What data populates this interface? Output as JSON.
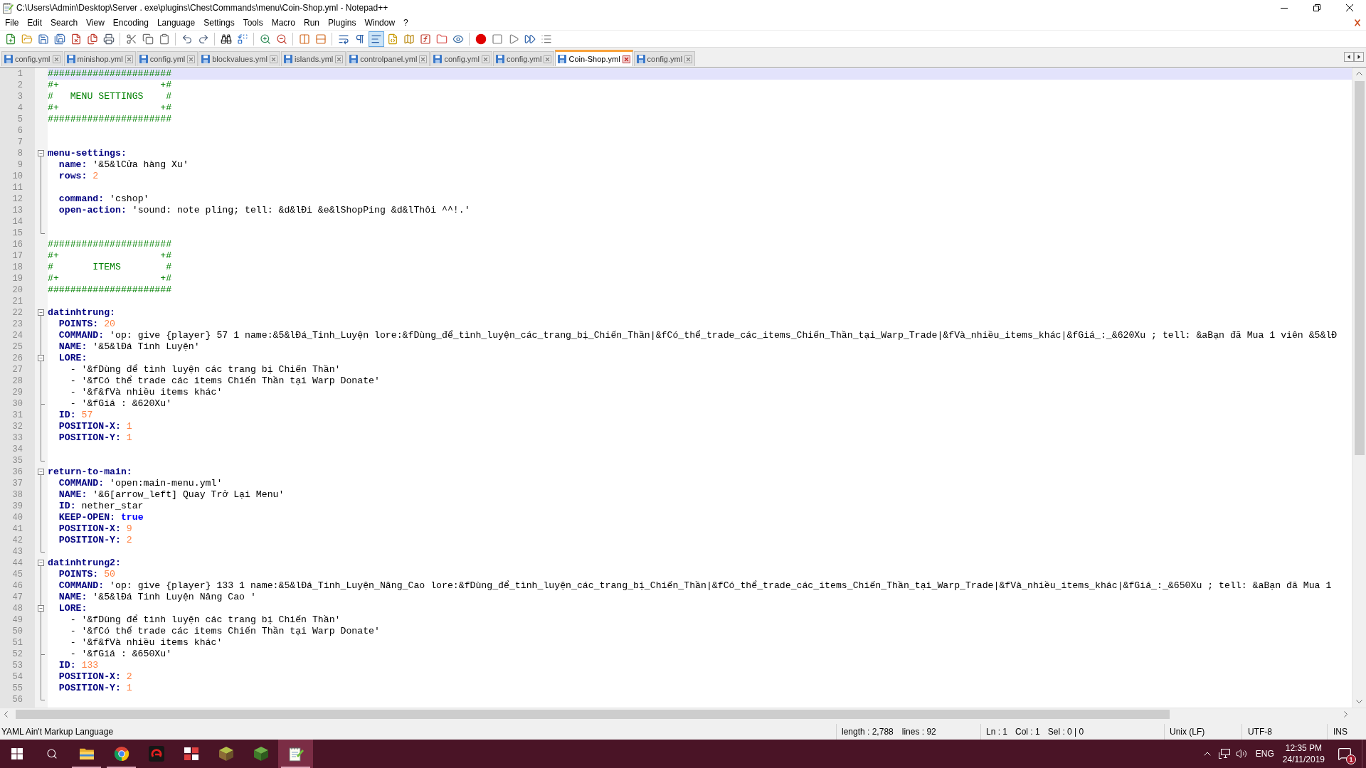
{
  "window": {
    "title": "C:\\Users\\Admin\\Desktop\\Server . exe\\plugins\\ChestCommands\\menu\\Coin-Shop.yml - Notepad++"
  },
  "menu_bar": [
    "File",
    "Edit",
    "Search",
    "View",
    "Encoding",
    "Language",
    "Settings",
    "Tools",
    "Macro",
    "Run",
    "Plugins",
    "Window",
    "?"
  ],
  "toolbar": {
    "groups": [
      {
        "buttons": [
          {
            "kind": "new",
            "pressed": false
          },
          {
            "kind": "open",
            "pressed": false
          },
          {
            "kind": "save",
            "pressed": false
          },
          {
            "kind": "saveall",
            "pressed": false
          },
          {
            "kind": "close",
            "pressed": false
          },
          {
            "kind": "closeall",
            "pressed": false
          },
          {
            "kind": "print",
            "pressed": false
          }
        ]
      },
      {
        "buttons": [
          {
            "kind": "cut",
            "pressed": false
          },
          {
            "kind": "copy",
            "pressed": false
          },
          {
            "kind": "paste",
            "pressed": false
          }
        ]
      },
      {
        "buttons": [
          {
            "kind": "undo",
            "pressed": false
          },
          {
            "kind": "redo",
            "pressed": false
          }
        ]
      },
      {
        "buttons": [
          {
            "kind": "find",
            "pressed": false
          },
          {
            "kind": "replace",
            "pressed": false
          }
        ]
      },
      {
        "buttons": [
          {
            "kind": "zoomin",
            "pressed": false
          },
          {
            "kind": "zoomout",
            "pressed": false
          }
        ]
      },
      {
        "buttons": [
          {
            "kind": "syncv",
            "pressed": false
          },
          {
            "kind": "synch",
            "pressed": false
          }
        ]
      },
      {
        "buttons": [
          {
            "kind": "wrap",
            "pressed": false
          },
          {
            "kind": "allchars",
            "pressed": false
          },
          {
            "kind": "indentguide",
            "pressed": true
          },
          {
            "kind": "udl",
            "pressed": false
          },
          {
            "kind": "docmap",
            "pressed": false
          },
          {
            "kind": "functions",
            "pressed": false
          },
          {
            "kind": "workspace",
            "pressed": false
          },
          {
            "kind": "monitor",
            "pressed": false
          }
        ]
      },
      {
        "buttons": [
          {
            "kind": "record",
            "pressed": false
          },
          {
            "kind": "stop",
            "pressed": false
          },
          {
            "kind": "play",
            "pressed": false
          },
          {
            "kind": "playmulti",
            "pressed": false
          },
          {
            "kind": "savemacro",
            "pressed": false
          }
        ]
      }
    ]
  },
  "tabs": [
    {
      "label": "config.yml",
      "selected": false
    },
    {
      "label": "minishop.yml",
      "selected": false
    },
    {
      "label": "config.yml",
      "selected": false
    },
    {
      "label": "blockvalues.yml",
      "selected": false
    },
    {
      "label": "islands.yml",
      "selected": false
    },
    {
      "label": "controlpanel.yml",
      "selected": false
    },
    {
      "label": "config.yml",
      "selected": false
    },
    {
      "label": "config.yml",
      "selected": false
    },
    {
      "label": "Coin-Shop.yml",
      "selected": true
    },
    {
      "label": "config.yml",
      "selected": false
    }
  ],
  "editor": {
    "lines": [
      {
        "number": "1",
        "current": true,
        "tokens": [
          {
            "kind": "comment",
            "text": "######################"
          }
        ]
      },
      {
        "number": "2",
        "current": false,
        "tokens": [
          {
            "kind": "comment",
            "text": "#+                  +#"
          }
        ]
      },
      {
        "number": "3",
        "current": false,
        "tokens": [
          {
            "kind": "comment",
            "text": "#   MENU SETTINGS    #"
          }
        ]
      },
      {
        "number": "4",
        "current": false,
        "tokens": [
          {
            "kind": "comment",
            "text": "#+                  +#"
          }
        ]
      },
      {
        "number": "5",
        "current": false,
        "tokens": [
          {
            "kind": "comment",
            "text": "######################"
          }
        ]
      },
      {
        "number": "6",
        "current": false
      },
      {
        "number": "7",
        "current": false
      },
      {
        "number": "8",
        "current": false,
        "fold": {
          "kind": "start"
        },
        "tokens": [
          {
            "kind": "key",
            "text": "menu-settings:"
          }
        ]
      },
      {
        "number": "9",
        "current": false,
        "fold": {
          "kind": "middle"
        },
        "tokens": [
          {
            "kind": "key",
            "text": "  name: "
          },
          {
            "kind": "plain",
            "text": "'&5&lCửa hàng Xu'"
          }
        ]
      },
      {
        "number": "10",
        "current": false,
        "fold": {
          "kind": "middle"
        },
        "tokens": [
          {
            "kind": "key",
            "text": "  rows: "
          },
          {
            "kind": "number",
            "text": "2"
          }
        ]
      },
      {
        "number": "11",
        "current": false,
        "fold": {
          "kind": "middle"
        }
      },
      {
        "number": "12",
        "current": false,
        "fold": {
          "kind": "middle"
        },
        "tokens": [
          {
            "kind": "key",
            "text": "  command: "
          },
          {
            "kind": "plain",
            "text": "'cshop'"
          }
        ]
      },
      {
        "number": "13",
        "current": false,
        "fold": {
          "kind": "middle"
        },
        "tokens": [
          {
            "kind": "key",
            "text": "  open-action: "
          },
          {
            "kind": "plain",
            "text": "'sound: note pling; tell: &d&lĐi &e&lShopPing &d&lThôi ^^!.'"
          }
        ]
      },
      {
        "number": "14",
        "current": false,
        "fold": {
          "kind": "middle"
        }
      },
      {
        "number": "15",
        "current": false,
        "fold": {
          "kind": "end"
        }
      },
      {
        "number": "16",
        "current": false,
        "tokens": [
          {
            "kind": "comment",
            "text": "######################"
          }
        ]
      },
      {
        "number": "17",
        "current": false,
        "tokens": [
          {
            "kind": "comment",
            "text": "#+                  +#"
          }
        ]
      },
      {
        "number": "18",
        "current": false,
        "tokens": [
          {
            "kind": "comment",
            "text": "#       ITEMS        #"
          }
        ]
      },
      {
        "number": "19",
        "current": false,
        "tokens": [
          {
            "kind": "comment",
            "text": "#+                  +#"
          }
        ]
      },
      {
        "number": "20",
        "current": false,
        "tokens": [
          {
            "kind": "comment",
            "text": "######################"
          }
        ]
      },
      {
        "number": "21",
        "current": false
      },
      {
        "number": "22",
        "current": false,
        "fold": {
          "kind": "start"
        },
        "tokens": [
          {
            "kind": "key",
            "text": "datinhtrung:"
          }
        ]
      },
      {
        "number": "23",
        "current": false,
        "fold": {
          "kind": "middle"
        },
        "tokens": [
          {
            "kind": "key",
            "text": "  POINTS: "
          },
          {
            "kind": "number",
            "text": "20"
          }
        ]
      },
      {
        "number": "24",
        "current": false,
        "fold": {
          "kind": "middle"
        },
        "tokens": [
          {
            "kind": "key",
            "text": "  COMMAND: "
          },
          {
            "kind": "plain",
            "text": "'op: give {player} 57 1 name:&5&lĐá_Tinh_Luyện lore:&fDùng_để_tình_luyện_các_trang_bị_Chiến_Thần|&fCó_thể_trade_các_items_Chiến_Thần_tại_Warp_Trade|&fVà_nhiều_items_khác|&fGiá_:_&620Xu ; tell: &aBạn đã Mua 1 viên &5&lĐ"
          }
        ]
      },
      {
        "number": "25",
        "current": false,
        "fold": {
          "kind": "middle"
        },
        "tokens": [
          {
            "kind": "key",
            "text": "  NAME: "
          },
          {
            "kind": "plain",
            "text": "'&5&lĐá Tinh Luyện'"
          }
        ]
      },
      {
        "number": "26",
        "current": false,
        "fold": {
          "kind": "substart"
        },
        "tokens": [
          {
            "kind": "key",
            "text": "  LORE:"
          }
        ]
      },
      {
        "number": "27",
        "current": false,
        "fold": {
          "kind": "middle"
        },
        "tokens": [
          {
            "kind": "plain",
            "text": "    - '&fDùng để tình luyện các trang bị Chiến Thần'"
          }
        ]
      },
      {
        "number": "28",
        "current": false,
        "fold": {
          "kind": "middle"
        },
        "tokens": [
          {
            "kind": "plain",
            "text": "    - '&fCó thể trade các items Chiến Thần tại Warp Donate'"
          }
        ]
      },
      {
        "number": "29",
        "current": false,
        "fold": {
          "kind": "middle"
        },
        "tokens": [
          {
            "kind": "plain",
            "text": "    - '&f&fVà nhiều items khác'"
          }
        ]
      },
      {
        "number": "30",
        "current": false,
        "fold": {
          "kind": "subend"
        },
        "tokens": [
          {
            "kind": "plain",
            "text": "    - '&fGiá : &620Xu'"
          }
        ]
      },
      {
        "number": "31",
        "current": false,
        "fold": {
          "kind": "middle"
        },
        "tokens": [
          {
            "kind": "key",
            "text": "  ID: "
          },
          {
            "kind": "number",
            "text": "57"
          }
        ]
      },
      {
        "number": "32",
        "current": false,
        "fold": {
          "kind": "middle"
        },
        "tokens": [
          {
            "kind": "key",
            "text": "  POSITION-X: "
          },
          {
            "kind": "number",
            "text": "1"
          }
        ]
      },
      {
        "number": "33",
        "current": false,
        "fold": {
          "kind": "middle"
        },
        "tokens": [
          {
            "kind": "key",
            "text": "  POSITION-Y: "
          },
          {
            "kind": "number",
            "text": "1"
          }
        ]
      },
      {
        "number": "34",
        "current": false,
        "fold": {
          "kind": "middle"
        }
      },
      {
        "number": "35",
        "current": false,
        "fold": {
          "kind": "end"
        }
      },
      {
        "number": "36",
        "current": false,
        "fold": {
          "kind": "start"
        },
        "tokens": [
          {
            "kind": "key",
            "text": "return-to-main:"
          }
        ]
      },
      {
        "number": "37",
        "current": false,
        "fold": {
          "kind": "middle"
        },
        "tokens": [
          {
            "kind": "key",
            "text": "  COMMAND: "
          },
          {
            "kind": "plain",
            "text": "'open:main-menu.yml'"
          }
        ]
      },
      {
        "number": "38",
        "current": false,
        "fold": {
          "kind": "middle"
        },
        "tokens": [
          {
            "kind": "key",
            "text": "  NAME: "
          },
          {
            "kind": "plain",
            "text": "'&6[arrow_left] Quay Trở Lại Menu'"
          }
        ]
      },
      {
        "number": "39",
        "current": false,
        "fold": {
          "kind": "middle"
        },
        "tokens": [
          {
            "kind": "key",
            "text": "  ID: "
          },
          {
            "kind": "plain",
            "text": "nether_star"
          }
        ]
      },
      {
        "number": "40",
        "current": false,
        "fold": {
          "kind": "middle"
        },
        "tokens": [
          {
            "kind": "key",
            "text": "  KEEP-OPEN: "
          },
          {
            "kind": "keyword",
            "text": "true"
          }
        ]
      },
      {
        "number": "41",
        "current": false,
        "fold": {
          "kind": "middle"
        },
        "tokens": [
          {
            "kind": "key",
            "text": "  POSITION-X: "
          },
          {
            "kind": "number",
            "text": "9"
          }
        ]
      },
      {
        "number": "42",
        "current": false,
        "fold": {
          "kind": "middle"
        },
        "tokens": [
          {
            "kind": "key",
            "text": "  POSITION-Y: "
          },
          {
            "kind": "number",
            "text": "2"
          }
        ]
      },
      {
        "number": "43",
        "current": false,
        "fold": {
          "kind": "end"
        }
      },
      {
        "number": "44",
        "current": false,
        "fold": {
          "kind": "start"
        },
        "tokens": [
          {
            "kind": "key",
            "text": "datinhtrung2:"
          }
        ]
      },
      {
        "number": "45",
        "current": false,
        "fold": {
          "kind": "middle"
        },
        "tokens": [
          {
            "kind": "key",
            "text": "  POINTS: "
          },
          {
            "kind": "number",
            "text": "50"
          }
        ]
      },
      {
        "number": "46",
        "current": false,
        "fold": {
          "kind": "middle"
        },
        "tokens": [
          {
            "kind": "key",
            "text": "  COMMAND: "
          },
          {
            "kind": "plain",
            "text": "'op: give {player} 133 1 name:&5&lĐá_Tinh_Luyện_Nâng_Cao lore:&fDùng_để_tình_luyện_các_trang_bị_Chiến_Thần|&fCó_thể_trade_các_items_Chiến_Thần_tại_Warp_Trade|&fVà_nhiều_items_khác|&fGiá_:_&650Xu ; tell: &aBạn đã Mua 1"
          }
        ]
      },
      {
        "number": "47",
        "current": false,
        "fold": {
          "kind": "middle"
        },
        "tokens": [
          {
            "kind": "key",
            "text": "  NAME: "
          },
          {
            "kind": "plain",
            "text": "'&5&lĐá Tinh Luyện Nâng Cao '"
          }
        ]
      },
      {
        "number": "48",
        "current": false,
        "fold": {
          "kind": "substart"
        },
        "tokens": [
          {
            "kind": "key",
            "text": "  LORE:"
          }
        ]
      },
      {
        "number": "49",
        "current": false,
        "fold": {
          "kind": "middle"
        },
        "tokens": [
          {
            "kind": "plain",
            "text": "    - '&fDùng để tình luyện các trang bị Chiến Thần'"
          }
        ]
      },
      {
        "number": "50",
        "current": false,
        "fold": {
          "kind": "middle"
        },
        "tokens": [
          {
            "kind": "plain",
            "text": "    - '&fCó thể trade các items Chiến Thần tại Warp Donate'"
          }
        ]
      },
      {
        "number": "51",
        "current": false,
        "fold": {
          "kind": "middle"
        },
        "tokens": [
          {
            "kind": "plain",
            "text": "    - '&f&fVà nhiều items khác'"
          }
        ]
      },
      {
        "number": "52",
        "current": false,
        "fold": {
          "kind": "subend"
        },
        "tokens": [
          {
            "kind": "plain",
            "text": "    - '&fGiá : &650Xu'"
          }
        ]
      },
      {
        "number": "53",
        "current": false,
        "fold": {
          "kind": "middle"
        },
        "tokens": [
          {
            "kind": "key",
            "text": "  ID: "
          },
          {
            "kind": "number",
            "text": "133"
          }
        ]
      },
      {
        "number": "54",
        "current": false,
        "fold": {
          "kind": "middle"
        },
        "tokens": [
          {
            "kind": "key",
            "text": "  POSITION-X: "
          },
          {
            "kind": "number",
            "text": "2"
          }
        ]
      },
      {
        "number": "55",
        "current": false,
        "fold": {
          "kind": "middle"
        },
        "tokens": [
          {
            "kind": "key",
            "text": "  POSITION-Y: "
          },
          {
            "kind": "number",
            "text": "1"
          }
        ]
      },
      {
        "number": "56",
        "current": false,
        "fold": {
          "kind": "end"
        }
      }
    ]
  },
  "status_bar": {
    "language": "YAML Ain't Markup Language",
    "length": "length : 2,788",
    "lines": "lines : 92",
    "line": "Ln : 1",
    "column": "Col : 1",
    "selection": "Sel : 0 | 0",
    "eol": "Unix (LF)",
    "encoding": "UTF-8",
    "mode": "INS"
  },
  "taskbar": {
    "apps": [
      {
        "kind": "explorer",
        "running": true,
        "active": false
      },
      {
        "kind": "browser",
        "running": true,
        "active": false
      },
      {
        "kind": "swirl",
        "running": false,
        "active": false
      },
      {
        "kind": "tiles",
        "running": false,
        "active": false
      },
      {
        "kind": "block",
        "running": false,
        "active": false
      },
      {
        "kind": "cube",
        "running": false,
        "active": false
      },
      {
        "kind": "notepad",
        "running": true,
        "active": true
      }
    ],
    "tray": {
      "language": "ENG",
      "time": "12:35 PM",
      "date": "24/11/2019",
      "notifications": "1"
    }
  }
}
